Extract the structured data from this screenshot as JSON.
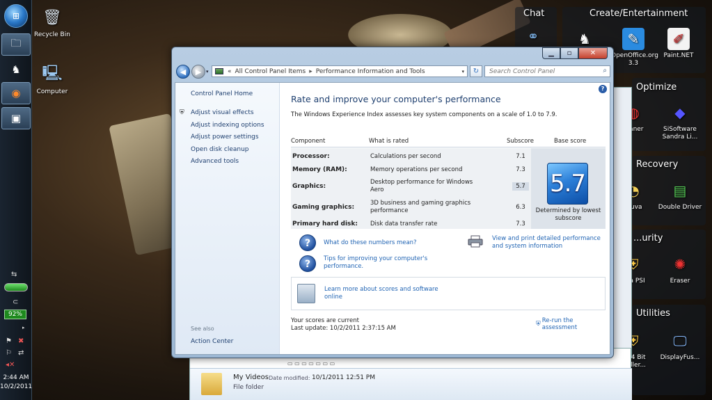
{
  "desktop": {
    "icons": [
      {
        "label": "Recycle Bin",
        "icon": "recycle-bin-icon"
      },
      {
        "label": "Computer",
        "icon": "computer-icon"
      }
    ]
  },
  "gadgets": {
    "chat": {
      "title": "Chat"
    },
    "create": {
      "title": "Create/Entertainment",
      "items": [
        "OpenOffice.org 3.3",
        "Paint.NET"
      ]
    },
    "optimize": {
      "title": "Optimize",
      "items": [
        "...aner",
        "SiSoftware Sandra Li..."
      ]
    },
    "recovery": {
      "title": "Recovery",
      "items": [
        "...uva",
        "Double Driver"
      ]
    },
    "security": {
      "title": "...urity",
      "items": [
        "...ia PSI",
        "Eraser"
      ]
    },
    "utilities": {
      "title": "Utilities",
      "items": [
        "...54 Bit ...aller...",
        "DisplayFus..."
      ]
    }
  },
  "taskbar": {
    "battery": "92%",
    "time": "2:44 AM",
    "date": "10/2/2011"
  },
  "background_window": {
    "name": "My Videos",
    "modified_label": "Date modified:",
    "modified_value": "10/1/2011 12:51 PM",
    "type": "File folder"
  },
  "window": {
    "address": {
      "root": "All Control Panel Items",
      "current": "Performance Information and Tools"
    },
    "search_placeholder": "Search Control Panel",
    "leftnav": {
      "home": "Control Panel Home",
      "links": [
        "Adjust visual effects",
        "Adjust indexing options",
        "Adjust power settings",
        "Open disk cleanup",
        "Advanced tools"
      ],
      "see_also": "See also",
      "action_center": "Action Center"
    },
    "title": "Rate and improve your computer's performance",
    "description": "The Windows Experience Index assesses key system components on a scale of 1.0 to 7.9.",
    "table": {
      "headers": [
        "Component",
        "What is rated",
        "Subscore",
        "Base score"
      ],
      "rows": [
        {
          "component": "Processor:",
          "rated": "Calculations per second",
          "subscore": "7.1"
        },
        {
          "component": "Memory (RAM):",
          "rated": "Memory operations per second",
          "subscore": "7.3"
        },
        {
          "component": "Graphics:",
          "rated": "Desktop performance for Windows Aero",
          "subscore": "5.7"
        },
        {
          "component": "Gaming graphics:",
          "rated": "3D business and gaming graphics performance",
          "subscore": "6.3"
        },
        {
          "component": "Primary hard disk:",
          "rated": "Disk data transfer rate",
          "subscore": "7.3"
        }
      ],
      "base_score": "5.7",
      "base_caption": "Determined by lowest subscore"
    },
    "links": {
      "what_numbers": "What do these numbers mean?",
      "tips": "Tips for improving your computer's performance.",
      "print": "View and print detailed performance and system information",
      "learn_more": "Learn more about scores and software online"
    },
    "status": {
      "current": "Your scores are current",
      "last_update": "Last update: 10/2/2011 2:37:15 AM",
      "rerun": "Re-run the assessment"
    }
  }
}
